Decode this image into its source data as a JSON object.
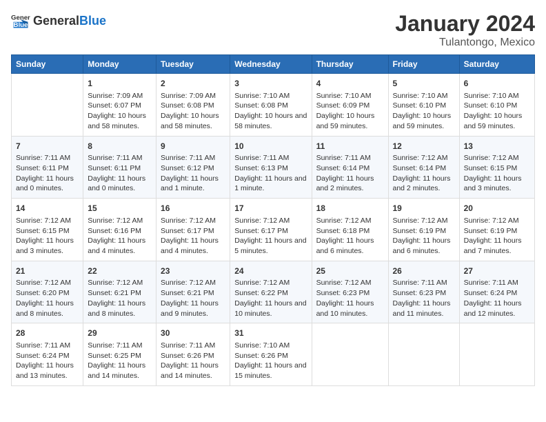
{
  "logo": {
    "general": "General",
    "blue": "Blue"
  },
  "header": {
    "title": "January 2024",
    "subtitle": "Tulantongo, Mexico"
  },
  "columns": [
    "Sunday",
    "Monday",
    "Tuesday",
    "Wednesday",
    "Thursday",
    "Friday",
    "Saturday"
  ],
  "weeks": [
    [
      {
        "day": "",
        "sunrise": "",
        "sunset": "",
        "daylight": ""
      },
      {
        "day": "1",
        "sunrise": "Sunrise: 7:09 AM",
        "sunset": "Sunset: 6:07 PM",
        "daylight": "Daylight: 10 hours and 58 minutes."
      },
      {
        "day": "2",
        "sunrise": "Sunrise: 7:09 AM",
        "sunset": "Sunset: 6:08 PM",
        "daylight": "Daylight: 10 hours and 58 minutes."
      },
      {
        "day": "3",
        "sunrise": "Sunrise: 7:10 AM",
        "sunset": "Sunset: 6:08 PM",
        "daylight": "Daylight: 10 hours and 58 minutes."
      },
      {
        "day": "4",
        "sunrise": "Sunrise: 7:10 AM",
        "sunset": "Sunset: 6:09 PM",
        "daylight": "Daylight: 10 hours and 59 minutes."
      },
      {
        "day": "5",
        "sunrise": "Sunrise: 7:10 AM",
        "sunset": "Sunset: 6:10 PM",
        "daylight": "Daylight: 10 hours and 59 minutes."
      },
      {
        "day": "6",
        "sunrise": "Sunrise: 7:10 AM",
        "sunset": "Sunset: 6:10 PM",
        "daylight": "Daylight: 10 hours and 59 minutes."
      }
    ],
    [
      {
        "day": "7",
        "sunrise": "Sunrise: 7:11 AM",
        "sunset": "Sunset: 6:11 PM",
        "daylight": "Daylight: 11 hours and 0 minutes."
      },
      {
        "day": "8",
        "sunrise": "Sunrise: 7:11 AM",
        "sunset": "Sunset: 6:11 PM",
        "daylight": "Daylight: 11 hours and 0 minutes."
      },
      {
        "day": "9",
        "sunrise": "Sunrise: 7:11 AM",
        "sunset": "Sunset: 6:12 PM",
        "daylight": "Daylight: 11 hours and 1 minute."
      },
      {
        "day": "10",
        "sunrise": "Sunrise: 7:11 AM",
        "sunset": "Sunset: 6:13 PM",
        "daylight": "Daylight: 11 hours and 1 minute."
      },
      {
        "day": "11",
        "sunrise": "Sunrise: 7:11 AM",
        "sunset": "Sunset: 6:14 PM",
        "daylight": "Daylight: 11 hours and 2 minutes."
      },
      {
        "day": "12",
        "sunrise": "Sunrise: 7:12 AM",
        "sunset": "Sunset: 6:14 PM",
        "daylight": "Daylight: 11 hours and 2 minutes."
      },
      {
        "day": "13",
        "sunrise": "Sunrise: 7:12 AM",
        "sunset": "Sunset: 6:15 PM",
        "daylight": "Daylight: 11 hours and 3 minutes."
      }
    ],
    [
      {
        "day": "14",
        "sunrise": "Sunrise: 7:12 AM",
        "sunset": "Sunset: 6:15 PM",
        "daylight": "Daylight: 11 hours and 3 minutes."
      },
      {
        "day": "15",
        "sunrise": "Sunrise: 7:12 AM",
        "sunset": "Sunset: 6:16 PM",
        "daylight": "Daylight: 11 hours and 4 minutes."
      },
      {
        "day": "16",
        "sunrise": "Sunrise: 7:12 AM",
        "sunset": "Sunset: 6:17 PM",
        "daylight": "Daylight: 11 hours and 4 minutes."
      },
      {
        "day": "17",
        "sunrise": "Sunrise: 7:12 AM",
        "sunset": "Sunset: 6:17 PM",
        "daylight": "Daylight: 11 hours and 5 minutes."
      },
      {
        "day": "18",
        "sunrise": "Sunrise: 7:12 AM",
        "sunset": "Sunset: 6:18 PM",
        "daylight": "Daylight: 11 hours and 6 minutes."
      },
      {
        "day": "19",
        "sunrise": "Sunrise: 7:12 AM",
        "sunset": "Sunset: 6:19 PM",
        "daylight": "Daylight: 11 hours and 6 minutes."
      },
      {
        "day": "20",
        "sunrise": "Sunrise: 7:12 AM",
        "sunset": "Sunset: 6:19 PM",
        "daylight": "Daylight: 11 hours and 7 minutes."
      }
    ],
    [
      {
        "day": "21",
        "sunrise": "Sunrise: 7:12 AM",
        "sunset": "Sunset: 6:20 PM",
        "daylight": "Daylight: 11 hours and 8 minutes."
      },
      {
        "day": "22",
        "sunrise": "Sunrise: 7:12 AM",
        "sunset": "Sunset: 6:21 PM",
        "daylight": "Daylight: 11 hours and 8 minutes."
      },
      {
        "day": "23",
        "sunrise": "Sunrise: 7:12 AM",
        "sunset": "Sunset: 6:21 PM",
        "daylight": "Daylight: 11 hours and 9 minutes."
      },
      {
        "day": "24",
        "sunrise": "Sunrise: 7:12 AM",
        "sunset": "Sunset: 6:22 PM",
        "daylight": "Daylight: 11 hours and 10 minutes."
      },
      {
        "day": "25",
        "sunrise": "Sunrise: 7:12 AM",
        "sunset": "Sunset: 6:23 PM",
        "daylight": "Daylight: 11 hours and 10 minutes."
      },
      {
        "day": "26",
        "sunrise": "Sunrise: 7:11 AM",
        "sunset": "Sunset: 6:23 PM",
        "daylight": "Daylight: 11 hours and 11 minutes."
      },
      {
        "day": "27",
        "sunrise": "Sunrise: 7:11 AM",
        "sunset": "Sunset: 6:24 PM",
        "daylight": "Daylight: 11 hours and 12 minutes."
      }
    ],
    [
      {
        "day": "28",
        "sunrise": "Sunrise: 7:11 AM",
        "sunset": "Sunset: 6:24 PM",
        "daylight": "Daylight: 11 hours and 13 minutes."
      },
      {
        "day": "29",
        "sunrise": "Sunrise: 7:11 AM",
        "sunset": "Sunset: 6:25 PM",
        "daylight": "Daylight: 11 hours and 14 minutes."
      },
      {
        "day": "30",
        "sunrise": "Sunrise: 7:11 AM",
        "sunset": "Sunset: 6:26 PM",
        "daylight": "Daylight: 11 hours and 14 minutes."
      },
      {
        "day": "31",
        "sunrise": "Sunrise: 7:10 AM",
        "sunset": "Sunset: 6:26 PM",
        "daylight": "Daylight: 11 hours and 15 minutes."
      },
      {
        "day": "",
        "sunrise": "",
        "sunset": "",
        "daylight": ""
      },
      {
        "day": "",
        "sunrise": "",
        "sunset": "",
        "daylight": ""
      },
      {
        "day": "",
        "sunrise": "",
        "sunset": "",
        "daylight": ""
      }
    ]
  ]
}
